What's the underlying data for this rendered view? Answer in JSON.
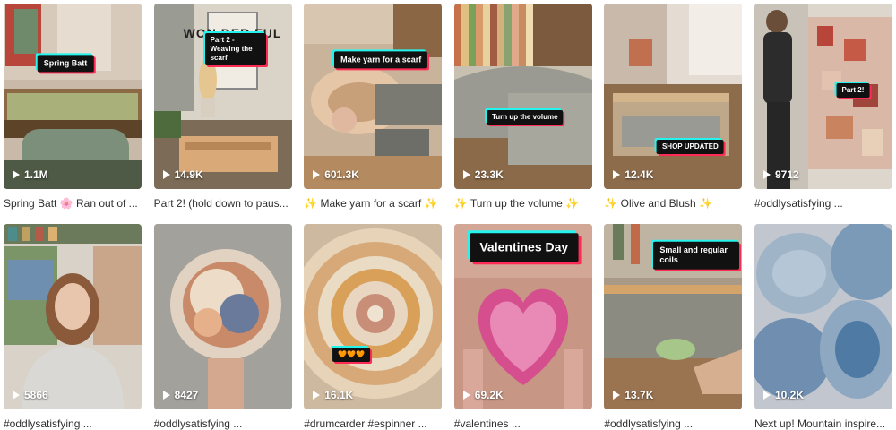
{
  "videos": [
    {
      "caption": "Spring Batt 🌸 Ran out of ...",
      "views": "1.1M",
      "overlay": "Spring Batt"
    },
    {
      "caption": "Part 2! (hold down to paus...",
      "views": "14.9K",
      "overlay": "Part 2 - Weaving the scarf",
      "wall_text": "WON DER FUL"
    },
    {
      "caption": "✨ Make yarn for a scarf ✨",
      "views": "601.3K",
      "overlay": "Make yarn for a scarf"
    },
    {
      "caption": "✨ Turn up the volume ✨",
      "views": "23.3K",
      "overlay": "Turn up the volume"
    },
    {
      "caption": "✨ Olive and Blush ✨",
      "views": "12.4K",
      "overlay": "SHOP UPDATED"
    },
    {
      "caption": "#oddlysatisfying ...",
      "views": "9712",
      "overlay": "Part 2!"
    },
    {
      "caption": "#oddlysatisfying ...",
      "views": "5866"
    },
    {
      "caption": "#oddlysatisfying ...",
      "views": "8427"
    },
    {
      "caption": "#drumcarder #espinner ...",
      "views": "16.1K",
      "overlay": "🧡🧡🧡"
    },
    {
      "caption": "#valentines ...",
      "views": "69.2K",
      "overlay": "Valentines Day"
    },
    {
      "caption": "#oddlysatisfying ...",
      "views": "13.7K",
      "overlay": "Small and regular coils"
    },
    {
      "caption": "Next up! Mountain inspire...",
      "views": "10.2K"
    }
  ],
  "colors": {
    "accent_cyan": "#25F4EE",
    "accent_red": "#FE2C55",
    "caption_text": "#2f2f2f"
  },
  "icons": {
    "views": "play-icon"
  }
}
